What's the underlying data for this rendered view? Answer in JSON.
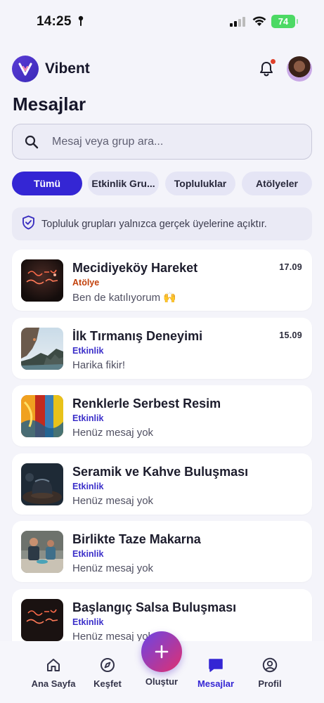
{
  "status_bar": {
    "time": "14:25",
    "battery": "74"
  },
  "header": {
    "app_name": "Vibent",
    "notification_dot": true
  },
  "page": {
    "title": "Mesajlar"
  },
  "search": {
    "placeholder": "Mesaj veya grup ara..."
  },
  "filters": [
    {
      "label": "Tümü",
      "active": true
    },
    {
      "label": "Etkinlik Gru...",
      "active": false
    },
    {
      "label": "Topluluklar",
      "active": false
    },
    {
      "label": "Atölyeler",
      "active": false
    }
  ],
  "info_banner": {
    "text": "Topluluk grupları yalnızca gerçek üyelerine açıktır."
  },
  "conversations": [
    {
      "title": "Mecidiyeköy Hareket",
      "type": "Atölye",
      "last_message": "Ben de katılıyorum 🙌",
      "date": "17.09",
      "thumb": "neon"
    },
    {
      "title": "İlk Tırmanış Deneyimi",
      "type": "Etkinlik",
      "last_message": "Harika fikir!",
      "date": "15.09",
      "thumb": "cliff"
    },
    {
      "title": "Renklerle Serbest Resim",
      "type": "Etkinlik",
      "last_message": "Henüz mesaj yok",
      "date": "",
      "thumb": "paint"
    },
    {
      "title": "Seramik ve Kahve Buluşması",
      "type": "Etkinlik",
      "last_message": "Henüz mesaj yok",
      "date": "",
      "thumb": "ceramic"
    },
    {
      "title": "Birlikte Taze Makarna",
      "type": "Etkinlik",
      "last_message": "Henüz mesaj yok",
      "date": "",
      "thumb": "kitchen"
    },
    {
      "title": "Başlangıç Salsa Buluşması",
      "type": "Etkinlik",
      "last_message": "Henüz mesaj yok",
      "date": "",
      "thumb": "neon"
    }
  ],
  "bottom_nav": {
    "home": "Ana Sayfa",
    "explore": "Keşfet",
    "create": "Oluştur",
    "messages": "Mesajlar",
    "profile": "Profil"
  },
  "colors": {
    "accent": "#3426d4",
    "atolye": "#c2410c",
    "etkinlik": "#3b2fc9"
  }
}
